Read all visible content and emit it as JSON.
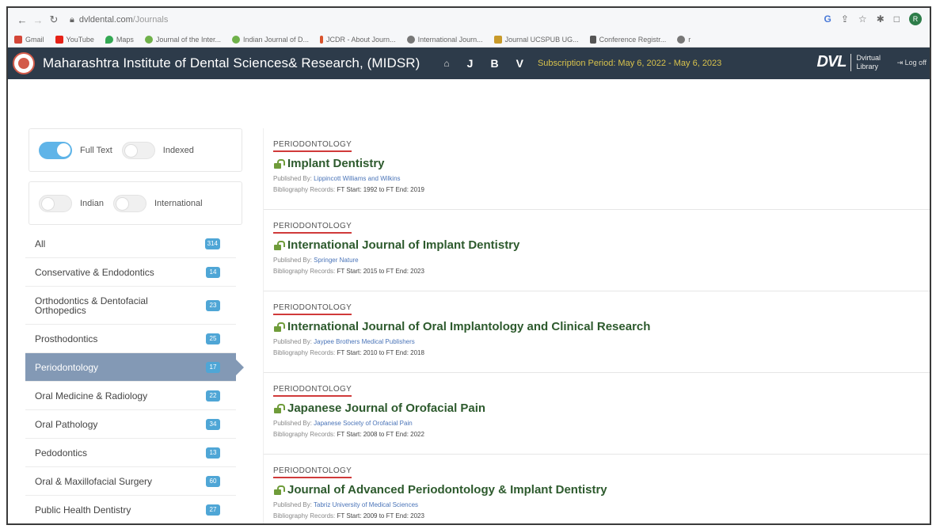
{
  "browser": {
    "url_domain": "dvldental.com",
    "url_path": "/Journals",
    "profile_initial": "R",
    "bookmarks": [
      "Gmail",
      "YouTube",
      "Maps",
      "Journal of the Inter...",
      "Indian Journal of D...",
      "JCDR - About Journ...",
      "International Journ...",
      "Journal UCSPUB UG...",
      "Conference Registr..."
    ]
  },
  "header": {
    "institution": "Maharashtra Institute of Dental Sciences& Research, (MIDSR)",
    "links": [
      "J",
      "B",
      "V"
    ],
    "subscription": "Subscription Period: May 6, 2022 - May 6, 2023",
    "brand_mark": "DVL",
    "brand_line1": "Dvirtual",
    "brand_line2": "Library",
    "logout": "Log off"
  },
  "filters": {
    "full_text": "Full Text",
    "indexed": "Indexed",
    "indian": "Indian",
    "international": "International"
  },
  "subjects": [
    {
      "label": "All",
      "count": "314"
    },
    {
      "label": "Conservative & Endodontics",
      "count": "14"
    },
    {
      "label": "Orthodontics & Dentofacial Orthopedics",
      "count": "23"
    },
    {
      "label": "Prosthodontics",
      "count": "25"
    },
    {
      "label": "Periodontology",
      "count": "17"
    },
    {
      "label": "Oral Medicine & Radiology",
      "count": "22"
    },
    {
      "label": "Oral Pathology",
      "count": "34"
    },
    {
      "label": "Pedodontics",
      "count": "13"
    },
    {
      "label": "Oral & Maxillofacial Surgery",
      "count": "60"
    },
    {
      "label": "Public Health Dentistry",
      "count": "27"
    }
  ],
  "journals": [
    {
      "subject": "PERIODONTOLOGY",
      "title": "Implant Dentistry",
      "publisher_label": "Published By:",
      "publisher": "Lippincott Williams and Wilkins",
      "bib_label": "Bibliography Records:",
      "ft": "FT Start: 1992 to FT End: 2019"
    },
    {
      "subject": "PERIODONTOLOGY",
      "title": "International Journal of Implant Dentistry",
      "publisher_label": "Published By:",
      "publisher": "Springer Nature",
      "bib_label": "Bibliography Records:",
      "ft": "FT Start: 2015 to FT End: 2023"
    },
    {
      "subject": "PERIODONTOLOGY",
      "title": "International Journal of Oral Implantology and Clinical Research",
      "publisher_label": "Published By:",
      "publisher": "Jaypee Brothers Medical Publishers",
      "bib_label": "Bibliography Records:",
      "ft": "FT Start: 2010 to FT End: 2018"
    },
    {
      "subject": "PERIODONTOLOGY",
      "title": "Japanese Journal of Orofacial Pain",
      "publisher_label": "Published By:",
      "publisher": "Japanese Society of Orofacial Pain",
      "bib_label": "Bibliography Records:",
      "ft": "FT Start: 2008 to FT End: 2022"
    },
    {
      "subject": "PERIODONTOLOGY",
      "title": "Journal of Advanced Periodontology & Implant Dentistry",
      "publisher_label": "Published By:",
      "publisher": "Tabriz University of Medical Sciences",
      "bib_label": "Bibliography Records:",
      "ft": "FT Start: 2009 to FT End: 2023"
    }
  ],
  "colors": {
    "header_bg": "#2d3b4a",
    "subscription_text": "#d8c24c",
    "active_subject": "#8399b5",
    "badge": "#4fa6d6",
    "subject_underline": "#d03a3a",
    "journal_title": "#2d5a2d"
  }
}
